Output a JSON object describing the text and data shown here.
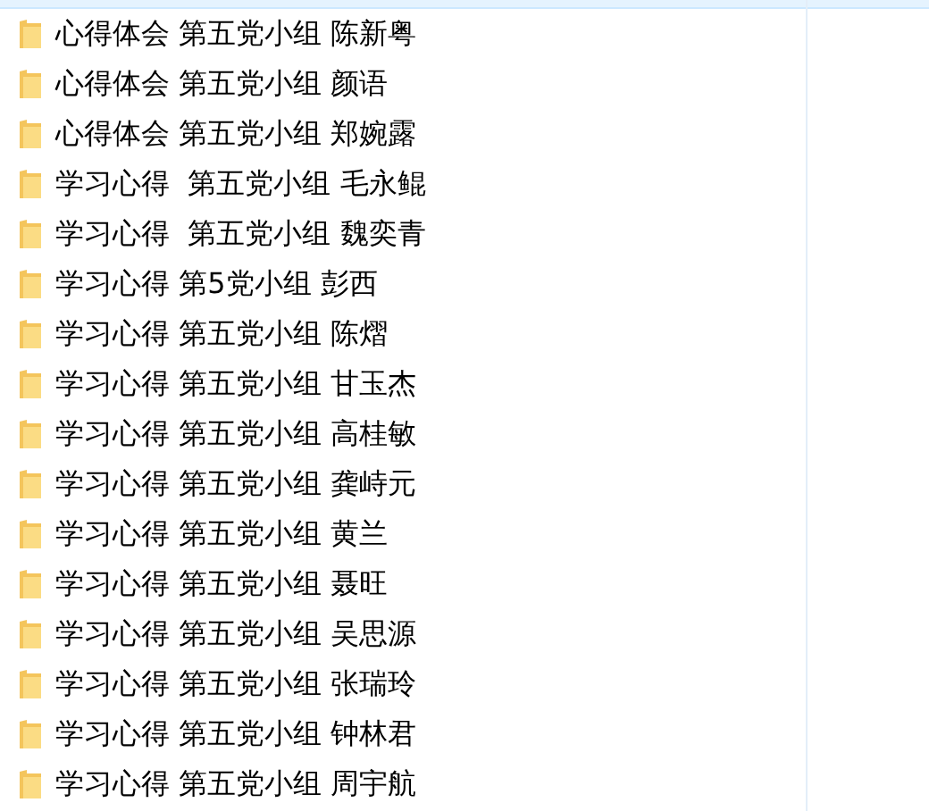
{
  "files": [
    {
      "name": "心得体会 第五党小组 陈新粤"
    },
    {
      "name": "心得体会 第五党小组 颜语"
    },
    {
      "name": "心得体会 第五党小组 郑婉露"
    },
    {
      "name": "学习心得  第五党小组 毛永鲲"
    },
    {
      "name": "学习心得  第五党小组 魏奕青"
    },
    {
      "name": "学习心得 第5党小组 彭西"
    },
    {
      "name": "学习心得 第五党小组 陈熠"
    },
    {
      "name": "学习心得 第五党小组 甘玉杰"
    },
    {
      "name": "学习心得 第五党小组 高桂敏"
    },
    {
      "name": "学习心得 第五党小组 龚峙元"
    },
    {
      "name": "学习心得 第五党小组 黄兰"
    },
    {
      "name": "学习心得 第五党小组 聂旺"
    },
    {
      "name": "学习心得 第五党小组 吴思源"
    },
    {
      "name": "学习心得 第五党小组 张瑞玲"
    },
    {
      "name": "学习心得 第五党小组 钟林君"
    },
    {
      "name": "学习心得 第五党小组 周宇航"
    }
  ]
}
